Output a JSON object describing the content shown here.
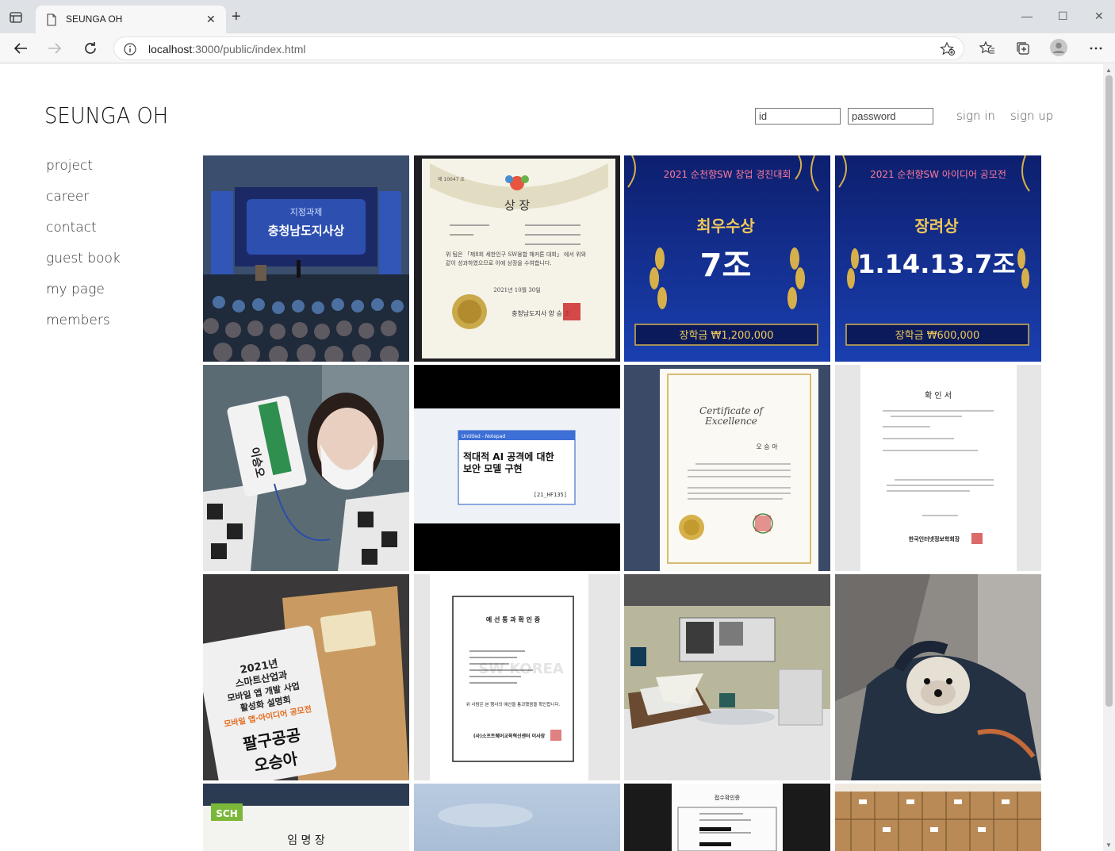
{
  "browser": {
    "tab_title": "SEUNGA OH",
    "url_host": "localhost",
    "url_rest": ":3000/public/index.html"
  },
  "site": {
    "logo": "SEUNGA OH",
    "id_placeholder": "id",
    "password_placeholder": "password",
    "sign_in": "sign in",
    "sign_up": "sign up"
  },
  "menu": [
    "project",
    "career",
    "contact",
    "guest book",
    "my page",
    "members"
  ],
  "gallery": {
    "t1": {
      "top": "지정과제",
      "main": "충청남도지사상"
    },
    "t2": {
      "no": "제 10047 호",
      "title": "상   장",
      "body": "위 팀은 「제8회 세한인구 SW융합 해커톤 대회」 에서 위와 같이 성과하였으므로 이에 상장을 수여합니다.",
      "date": "2021년 10월 30일",
      "sign": "충청남도지사 양 승 조"
    },
    "t3": {
      "header": "2021 순천향SW 창업 경진대회",
      "award": "최우수상",
      "team": "7조",
      "prize": "장학금  ₩1,200,000"
    },
    "t4": {
      "header": "2021 순천향SW 아이디어 공모전",
      "award": "장려상",
      "team": "1.14.13.7조",
      "prize": "장학금  ₩600,000"
    },
    "t5": {
      "badge": "이승오"
    },
    "t6": {
      "window_title": "Untitled - Notepad",
      "line1": "적대적 AI 공격에 대한",
      "line2": "보안 모델 구현",
      "code": "[21_HF135]"
    },
    "t7": {
      "title": "Certificate of",
      "title2": "Excellence",
      "name": "오 승 아"
    },
    "t8": {
      "title": "확 인 서",
      "sign": "한국인터넷정보학회장"
    },
    "t9": {
      "l1": "2021년",
      "l2": "스마트산업과",
      "l3": "모바일 앱 개발 사업",
      "l4": "활성화 설명회",
      "l5": "모바일 앱·아이디어 공모전",
      "l6": "팔구공공",
      "l7": "오승아"
    },
    "t10": {
      "title": "예 선 통 과 확 인 증",
      "note": "위 사람은 본 행사의 예선을 통과했음을 확인합니다.",
      "sign": "(사)소프트웨어교육혁신센터 이사장",
      "watermark": "SW KOREA"
    },
    "t13": {
      "logo": "SCH",
      "title": "임   명   장"
    },
    "t15": {
      "title": "접수확인증"
    }
  }
}
